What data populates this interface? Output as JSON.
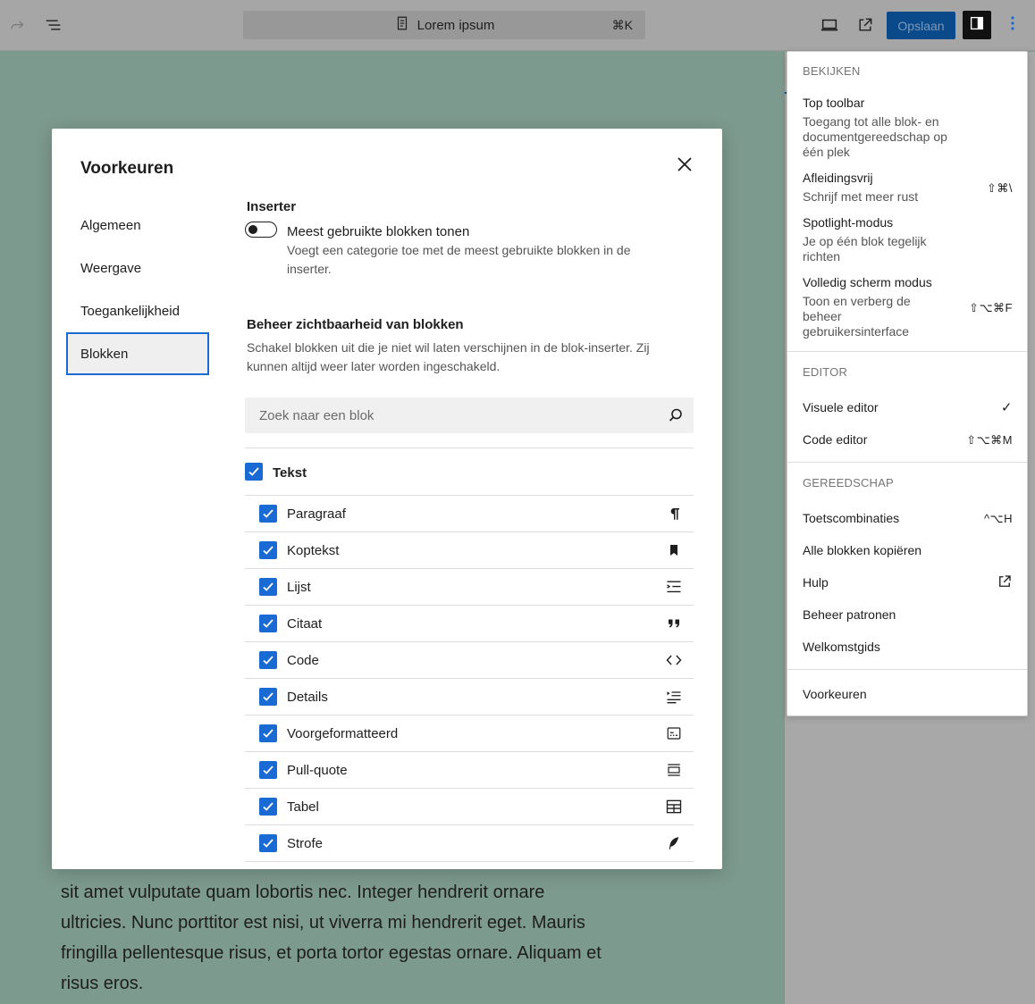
{
  "topbar": {
    "document_title": "Lorem ipsum",
    "command_shortcut": "⌘K",
    "save_label": "Opslaan"
  },
  "background_text": "sit amet vulputate quam lobortis nec. Integer hendrerit ornare ultricies. Nunc porttitor est nisi, ut viverra mi hendrerit eget. Mauris fringilla pellentesque risus, et porta tortor egestas ornare. Aliquam et risus eros.",
  "modal": {
    "title": "Voorkeuren",
    "nav": [
      "Algemeen",
      "Weergave",
      "Toegankelijkheid",
      "Blokken"
    ],
    "active_nav": "Blokken",
    "inserter": {
      "title": "Inserter",
      "toggle_label": "Meest gebruikte blokken tonen",
      "toggle_help": "Voegt een categorie toe met de meest gebruikte blokken in de inserter.",
      "toggle_on": false
    },
    "visibility": {
      "title": "Beheer zichtbaarheid van blokken",
      "help": "Schakel blokken uit die je niet wil laten verschijnen in de blok-inserter. Zij kunnen altijd weer later worden ingeschakeld.",
      "search_placeholder": "Zoek naar een blok",
      "category": "Tekst",
      "blocks": [
        {
          "label": "Paragraaf",
          "icon": "paragraph-icon",
          "checked": true
        },
        {
          "label": "Koptekst",
          "icon": "bookmark-icon",
          "checked": true
        },
        {
          "label": "Lijst",
          "icon": "list-icon",
          "checked": true
        },
        {
          "label": "Citaat",
          "icon": "quote-icon",
          "checked": true
        },
        {
          "label": "Code",
          "icon": "code-icon",
          "checked": true
        },
        {
          "label": "Details",
          "icon": "details-icon",
          "checked": true
        },
        {
          "label": "Voorgeformatteerd",
          "icon": "preformatted-icon",
          "checked": true
        },
        {
          "label": "Pull-quote",
          "icon": "pullquote-icon",
          "checked": true
        },
        {
          "label": "Tabel",
          "icon": "table-icon",
          "checked": true
        },
        {
          "label": "Strofe",
          "icon": "feather-icon",
          "checked": true
        }
      ]
    }
  },
  "menu": {
    "view_heading": "BEKIJKEN",
    "top_toolbar": {
      "title": "Top toolbar",
      "desc": "Toegang tot alle blok- en documentgereedschap op één plek"
    },
    "distraction_free": {
      "title": "Afleidingsvrij",
      "desc": "Schrijf met meer rust",
      "shortcut": "⇧⌘\\"
    },
    "spotlight": {
      "title": "Spotlight-modus",
      "desc": "Je op één blok tegelijk richten"
    },
    "fullscreen": {
      "title": "Volledig scherm modus",
      "desc": "Toon en verberg de beheer gebruikersinterface",
      "shortcut": "⇧⌥⌘F"
    },
    "editor_heading": "EDITOR",
    "visual_editor": {
      "title": "Visuele editor",
      "checkmark": "✓"
    },
    "code_editor": {
      "title": "Code editor",
      "shortcut": "⇧⌥⌘M"
    },
    "tools_heading": "GEREEDSCHAP",
    "keyboard_shortcuts": {
      "title": "Toetscombinaties",
      "shortcut": "^⌥H"
    },
    "copy_all_blocks": "Alle blokken kopiëren",
    "help": "Hulp",
    "manage_patterns": "Beheer patronen",
    "welcome_guide": "Welkomstgids",
    "preferences": "Voorkeuren"
  },
  "colors": {
    "accent": "#1a6ad4",
    "canvas_bg": "#7d9a8e",
    "save_button": "#0a4a8a"
  }
}
